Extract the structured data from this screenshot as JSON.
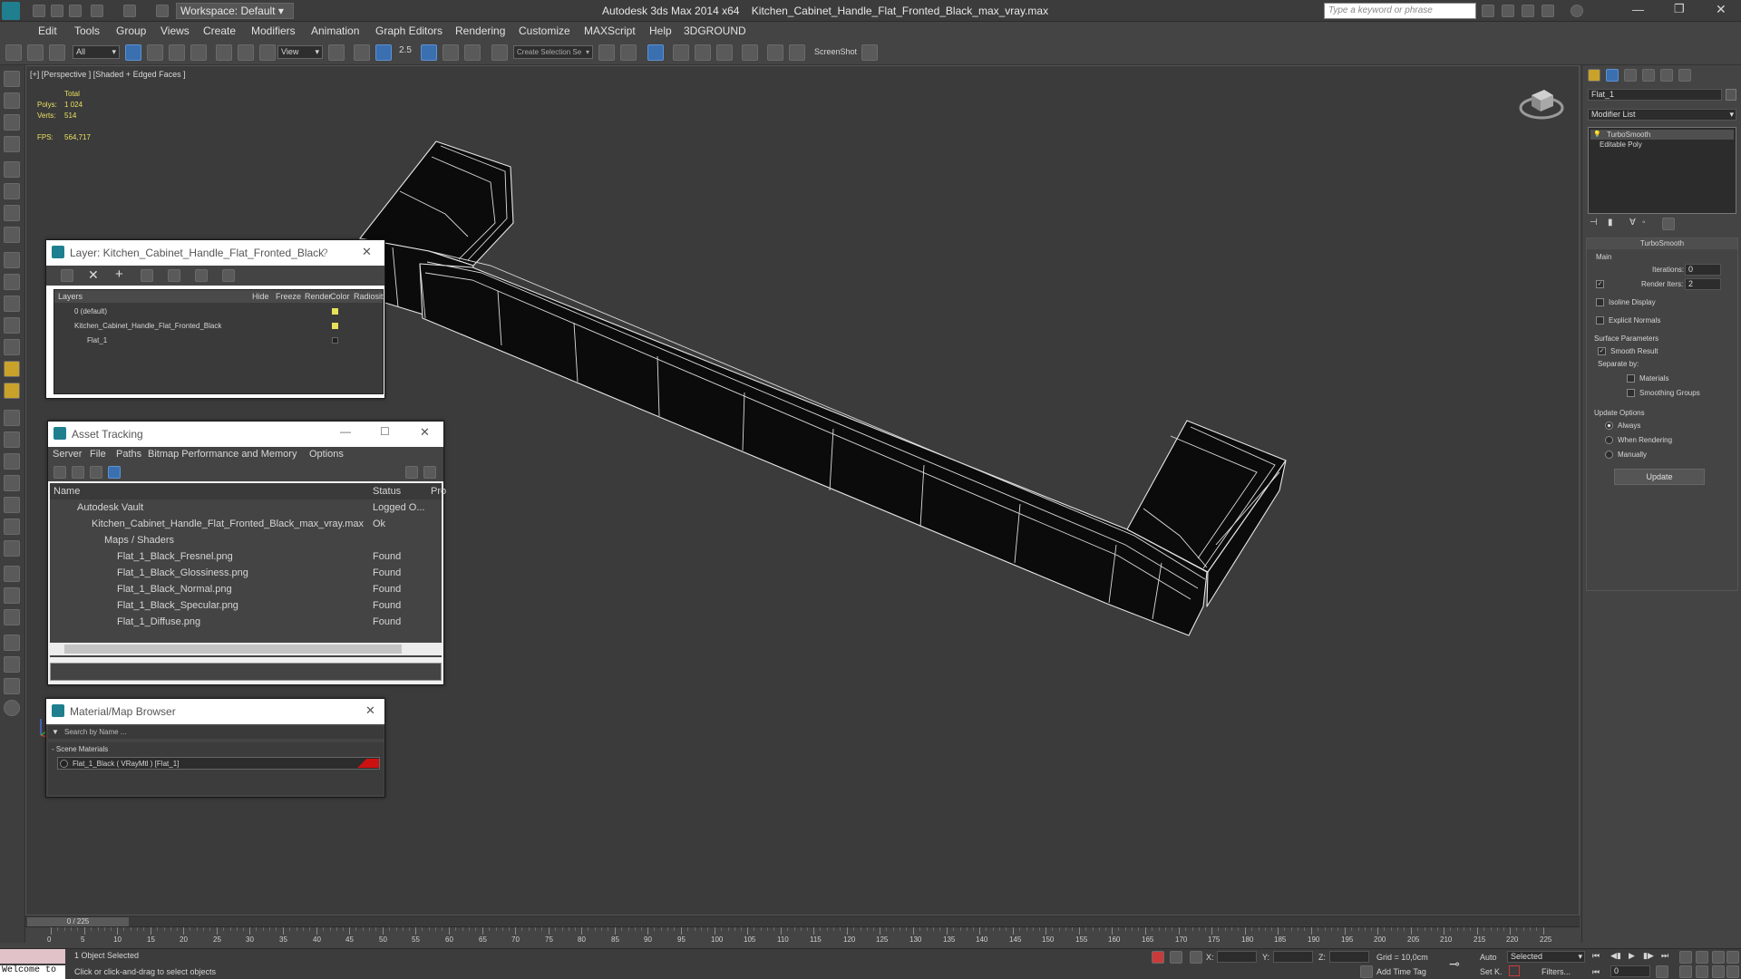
{
  "titlebar": {
    "workspace": "Workspace: Default",
    "app_title": "Autodesk 3ds Max  2014 x64",
    "file_title": "Kitchen_Cabinet_Handle_Flat_Fronted_Black_max_vray.max",
    "search_placeholder": "Type a keyword or phrase"
  },
  "menu": [
    "Edit",
    "Tools",
    "Group",
    "Views",
    "Create",
    "Modifiers",
    "Animation",
    "Graph Editors",
    "Rendering",
    "Customize",
    "MAXScript",
    "Help",
    "3DGROUND"
  ],
  "toolbar": {
    "filter_value": "All",
    "refcoord_value": "View",
    "named_sel_placeholder": "Create Selection Se",
    "snap_label": "2.5",
    "screenshot_label": "ScreenShot"
  },
  "viewport": {
    "label": "[+] [Perspective ] [Shaded + Edged Faces ]",
    "stats_header": "Total",
    "polys_label": "Polys:",
    "polys_value": "1 024",
    "verts_label": "Verts:",
    "verts_value": "514",
    "fps_label": "FPS:",
    "fps_value": "564,717"
  },
  "layer_window": {
    "title": "Layer: Kitchen_Cabinet_Handle_Flat_Fronted_Black",
    "help": "?",
    "columns": [
      "Layers",
      "Hide",
      "Freeze",
      "Render",
      "Color",
      "Radiosit"
    ],
    "rows": [
      {
        "name": "0 (default)",
        "color": "#e8e05a"
      },
      {
        "name": "Kitchen_Cabinet_Handle_Flat_Fronted_Black",
        "color": "#e8e05a"
      },
      {
        "name": "Flat_1",
        "color": "#222222"
      }
    ]
  },
  "asset_window": {
    "title": "Asset Tracking",
    "menu": [
      "Server",
      "File",
      "Paths",
      "Bitmap Performance and Memory",
      "Options"
    ],
    "columns": [
      "Name",
      "Status",
      "Pro"
    ],
    "rows": [
      {
        "name": "Autodesk Vault",
        "status": "Logged O..."
      },
      {
        "name": "Kitchen_Cabinet_Handle_Flat_Fronted_Black_max_vray.max",
        "status": "Ok"
      },
      {
        "name": "Maps / Shaders",
        "status": ""
      },
      {
        "name": "Flat_1_Black_Fresnel.png",
        "status": "Found"
      },
      {
        "name": "Flat_1_Black_Glossiness.png",
        "status": "Found"
      },
      {
        "name": "Flat_1_Black_Normal.png",
        "status": "Found"
      },
      {
        "name": "Flat_1_Black_Specular.png",
        "status": "Found"
      },
      {
        "name": "Flat_1_Diffuse.png",
        "status": "Found"
      }
    ]
  },
  "material_window": {
    "title": "Material/Map Browser",
    "search_placeholder": "Search by Name ...",
    "section": "- Scene Materials",
    "item": "Flat_1_Black  ( VRayMtl )  [Flat_1]"
  },
  "command_panel": {
    "object_name": "Flat_1",
    "modifier_list": "Modifier List",
    "stack": [
      "TurboSmooth",
      "Editable Poly"
    ],
    "rollout_title": "TurboSmooth",
    "main_label": "Main",
    "iterations_label": "Iterations:",
    "iterations_value": "0",
    "render_iters_label": "Render Iters:",
    "render_iters_value": "2",
    "isoline": "Isoline Display",
    "explicit_normals": "Explicit Normals",
    "surface_params": "Surface Parameters",
    "smooth_result": "Smooth Result",
    "separate_by": "Separate by:",
    "materials": "Materials",
    "smoothing_groups": "Smoothing Groups",
    "update_options": "Update Options",
    "always": "Always",
    "when_rendering": "When Rendering",
    "manually": "Manually",
    "update_button": "Update"
  },
  "timeline": {
    "frame_indicator": "0 / 225",
    "ticks": [
      "0",
      "5",
      "10",
      "15",
      "20",
      "25",
      "30",
      "35",
      "40",
      "45",
      "50",
      "55",
      "60",
      "65",
      "70",
      "75",
      "80",
      "85",
      "90",
      "95",
      "100",
      "105",
      "110",
      "115",
      "120",
      "125",
      "130",
      "135",
      "140",
      "145",
      "150",
      "155",
      "160",
      "165",
      "170",
      "175",
      "180",
      "185",
      "190",
      "195",
      "200",
      "205",
      "210",
      "215",
      "220",
      "225"
    ]
  },
  "status": {
    "welcome": "Welcome to",
    "selected": "1 Object Selected",
    "prompt": "Click or click-and-drag to select objects",
    "x_label": "X:",
    "y_label": "Y:",
    "z_label": "Z:",
    "grid": "Grid = 10,0cm",
    "add_time_tag": "Add Time Tag",
    "auto": "Auto",
    "set_k": "Set K.",
    "selected_dropdown": "Selected",
    "filters": "Filters...",
    "frame_value": "0"
  },
  "colors": {
    "accent": "#3a6fb0",
    "viewport_bg": "#3b3b3b",
    "material_swatch": "#cc1111"
  }
}
